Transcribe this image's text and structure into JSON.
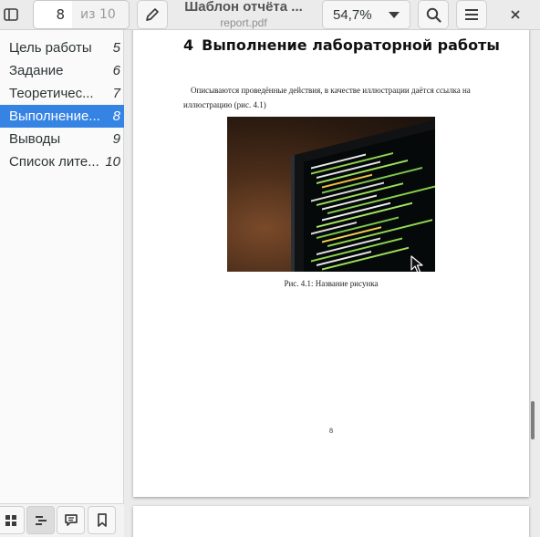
{
  "header": {
    "page_number_value": "8",
    "page_total": "из 10",
    "title": "Шаблон отчёта ...",
    "subtitle": "report.pdf",
    "zoom": "54,7%"
  },
  "sidebar": {
    "items": [
      {
        "label": "Цель работы",
        "page": "5"
      },
      {
        "label": "Задание",
        "page": "6"
      },
      {
        "label": "Теоретичес...",
        "page": "7"
      },
      {
        "label": "Выполнение...",
        "page": "8"
      },
      {
        "label": "Выводы",
        "page": "9"
      },
      {
        "label": "Список лите...",
        "page": "10"
      }
    ],
    "active_index": 3
  },
  "document": {
    "heading_number": "4",
    "heading_text": "Выполнение лабораторной работы",
    "paragraph": "Описываются проведённые действия, в качестве иллюстрации даётся ссылка на иллюстрацию (рис. 4.1)",
    "caption": "Рис. 4.1: Название рисунка",
    "page_number": "8"
  },
  "icons": {
    "sidebar_toggle": "sidebar-icon",
    "annotate": "pencil-icon",
    "search": "search-icon",
    "menu": "hamburger-icon",
    "close": "close-icon",
    "thumbnails": "grid-icon",
    "outline": "outline-icon",
    "annotations": "comment-icon",
    "bookmarks": "bookmark-icon"
  },
  "colors": {
    "accent": "#3584e4",
    "header_bg": "#ebebeb",
    "sidebar_bg": "#fafafa"
  }
}
